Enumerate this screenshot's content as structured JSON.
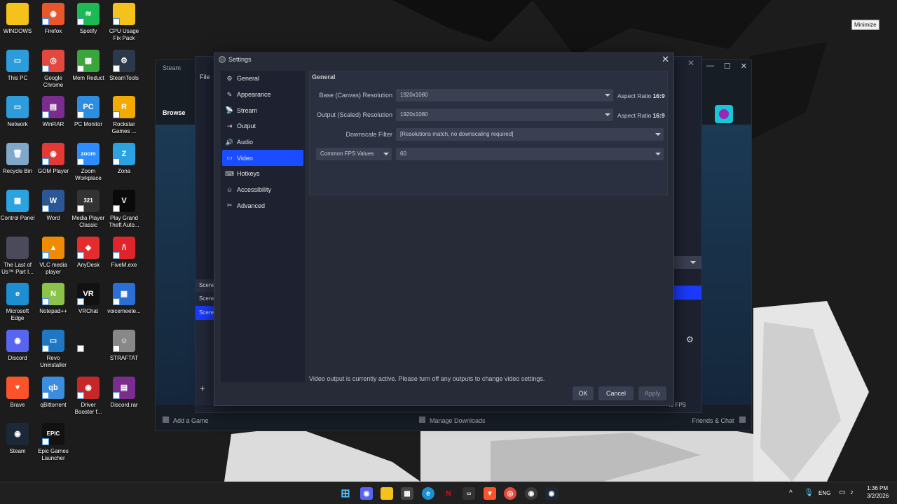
{
  "desktop": {
    "icons": [
      {
        "label": "WINDOWS",
        "color": "#f5c21b",
        "glyph": ""
      },
      {
        "label": "Firefox",
        "color": "#e8572b",
        "glyph": "◉"
      },
      {
        "label": "Spotify",
        "color": "#1db954",
        "glyph": "≋"
      },
      {
        "label": "CPU Usage Fix Pack",
        "color": "#f5c21b",
        "glyph": ""
      },
      {
        "label": "This PC",
        "color": "#2d9cdb",
        "glyph": "▭"
      },
      {
        "label": "Google Chrome",
        "color": "#e2483d",
        "glyph": "◎"
      },
      {
        "label": "Mem Reduct",
        "color": "#3aa53a",
        "glyph": "▦"
      },
      {
        "label": "SteamTools",
        "color": "#2a3a4a",
        "glyph": "⚙"
      },
      {
        "label": "Network",
        "color": "#2d9cdb",
        "glyph": "▭"
      },
      {
        "label": "WinRAR",
        "color": "#7b2c8f",
        "glyph": "▤"
      },
      {
        "label": "PC Monitor",
        "color": "#2d8de0",
        "glyph": "PC"
      },
      {
        "label": "Rockstar Games ...",
        "color": "#f2a900",
        "glyph": "R"
      },
      {
        "label": "Recycle Bin",
        "color": "#7fa8c9",
        "glyph": "🗑"
      },
      {
        "label": "GOM Player",
        "color": "#e53935",
        "glyph": "◉"
      },
      {
        "label": "Zoom Workplace",
        "color": "#2d8cff",
        "glyph": "zoom"
      },
      {
        "label": "Zona",
        "color": "#2ba3e0",
        "glyph": "Z"
      },
      {
        "label": "Control Panel",
        "color": "#2ba3e0",
        "glyph": "▦"
      },
      {
        "label": "Word",
        "color": "#2b5797",
        "glyph": "W"
      },
      {
        "label": "Media Player Classic",
        "color": "#333",
        "glyph": "321"
      },
      {
        "label": "Play Grand Theft Auto...",
        "color": "#0a0a0a",
        "glyph": "V"
      },
      {
        "label": "The Last of Us™ Part I...",
        "color": "#4a4a5a",
        "glyph": ""
      },
      {
        "label": "VLC media player",
        "color": "#f08a00",
        "glyph": "▲"
      },
      {
        "label": "AnyDesk",
        "color": "#e52c2c",
        "glyph": "◆"
      },
      {
        "label": "FiveM.exe",
        "color": "#e0242c",
        "glyph": "/\\"
      },
      {
        "label": "Microsoft Edge",
        "color": "#1d8fd1",
        "glyph": "e"
      },
      {
        "label": "Notepad++",
        "color": "#8bc34a",
        "glyph": "N"
      },
      {
        "label": "VRChat",
        "color": "#111",
        "glyph": "VR"
      },
      {
        "label": "voicemeete...",
        "color": "#2b6fd6",
        "glyph": "▦"
      },
      {
        "label": "Discord",
        "color": "#5865f2",
        "glyph": "◉"
      },
      {
        "label": "Revo Uninstaller",
        "color": "#1f77c4",
        "glyph": "▭"
      },
      {
        "label": "",
        "color": "transparent",
        "glyph": ""
      },
      {
        "label": "STRAFTAT",
        "color": "#888",
        "glyph": "☺"
      },
      {
        "label": "Brave",
        "color": "#fb542b",
        "glyph": "▼"
      },
      {
        "label": "qBittorrent",
        "color": "#3c8de0",
        "glyph": "qb"
      },
      {
        "label": "Driver Booster f...",
        "color": "#c62828",
        "glyph": "◉"
      },
      {
        "label": "Discord.rar",
        "color": "#7b2c8f",
        "glyph": "▤"
      },
      {
        "label": "Steam",
        "color": "#1b2838",
        "glyph": "◉"
      },
      {
        "label": "Epic Games Launcher",
        "color": "#111",
        "glyph": "EPIC"
      }
    ]
  },
  "tooltip": {
    "minimize": "Minimize"
  },
  "steam": {
    "title": "Steam",
    "browse": "Browse",
    "add_game": "Add a Game",
    "manage_downloads": "Manage Downloads",
    "friends_chat": "Friends & Chat"
  },
  "obs": {
    "file_menu": "File",
    "scenes_header": "Scene",
    "scene_items": [
      "Scene",
      "Scene"
    ],
    "fps_readout": "40 FPS"
  },
  "settings": {
    "title": "Settings",
    "sidebar": [
      {
        "label": "General",
        "icon": "gear-icon",
        "glyph": "⚙"
      },
      {
        "label": "Appearance",
        "icon": "appearance-icon",
        "glyph": "✎"
      },
      {
        "label": "Stream",
        "icon": "stream-icon",
        "glyph": "📡"
      },
      {
        "label": "Output",
        "icon": "output-icon",
        "glyph": "⇥"
      },
      {
        "label": "Audio",
        "icon": "audio-icon",
        "glyph": "🔊"
      },
      {
        "label": "Video",
        "icon": "video-icon",
        "glyph": "▭"
      },
      {
        "label": "Hotkeys",
        "icon": "keyboard-icon",
        "glyph": "⌨"
      },
      {
        "label": "Accessibility",
        "icon": "accessibility-icon",
        "glyph": "☺"
      },
      {
        "label": "Advanced",
        "icon": "tools-icon",
        "glyph": "✂"
      }
    ],
    "active_index": 5,
    "panel": {
      "title": "General",
      "base_label": "Base (Canvas) Resolution",
      "base_value": "1920x1080",
      "base_aspect_prefix": "Aspect Ratio",
      "base_aspect_value": "16:9",
      "output_label": "Output (Scaled) Resolution",
      "output_value": "1920x1080",
      "output_aspect_prefix": "Aspect Ratio",
      "output_aspect_value": "16:9",
      "downscale_label": "Downscale Filter",
      "downscale_value": "[Resolutions match, no downscaling required]",
      "fps_type": "Common FPS Values",
      "fps_value": "60"
    },
    "notice": "Video output is currently active. Please turn off any outputs to change video settings.",
    "ok": "OK",
    "cancel": "Cancel",
    "apply": "Apply"
  },
  "taskbar": {
    "lang": "ENG",
    "time": "1:36 PM",
    "date": "3/2/2026"
  }
}
